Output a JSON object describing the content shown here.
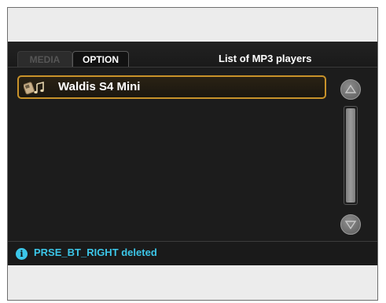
{
  "tabs": [
    {
      "label": "MEDIA",
      "active": false
    },
    {
      "label": "OPTION",
      "active": true
    }
  ],
  "header": {
    "title": "List of MP3 players"
  },
  "list": {
    "items": [
      {
        "label": "Waldis S4 Mini",
        "icon": "mp3-player-music-icon",
        "selected": true
      }
    ]
  },
  "status": {
    "icon": "info-icon",
    "message": "PRSE_BT_RIGHT deleted"
  },
  "colors": {
    "accent_orange": "#c8922a",
    "status_cyan": "#3cc6e8",
    "screen_bg": "#1c1c1c"
  }
}
